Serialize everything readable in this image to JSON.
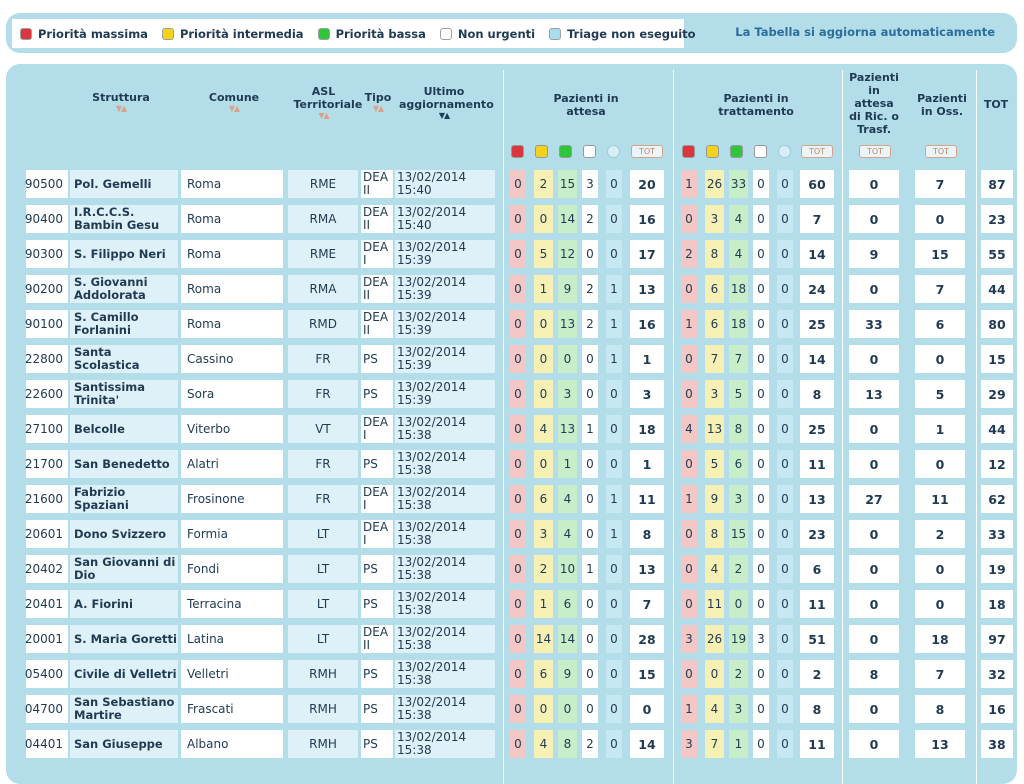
{
  "legend": {
    "items": [
      {
        "label": "Priorità massima",
        "color": "#d9363e"
      },
      {
        "label": "Priorità intermedia",
        "color": "#f2d21b"
      },
      {
        "label": "Priorità bassa",
        "color": "#2fc63c"
      },
      {
        "label": "Non urgenti",
        "color": "#ffffff"
      },
      {
        "label": "Triage non eseguito",
        "color": "#a9dcec"
      }
    ],
    "auto_update": "La Tabella si aggiorna automaticamente"
  },
  "headers": {
    "struttura": "Struttura",
    "comune": "Comune",
    "asl": "ASL Territoriale",
    "tipo": "Tipo",
    "ultimo": "Ultimo aggiornamento",
    "attesa": "Pazienti in attesa",
    "trattamento": "Pazienti in trattamento",
    "ric": "Pazienti in attesa di Ric. o Trasf.",
    "oss": "Pazienti in Oss.",
    "tot": "TOT",
    "tot_small": "TOT"
  },
  "rows": [
    {
      "code": "90500",
      "name": "Pol. Gemelli",
      "comune": "Roma",
      "asl": "RME",
      "tipo": "DEA II",
      "agg": "13/02/2014 15:40",
      "a": [
        "0",
        "2",
        "15",
        "3",
        "0"
      ],
      "at": "20",
      "t": [
        "1",
        "26",
        "33",
        "0",
        "0"
      ],
      "tt": "60",
      "ric": "0",
      "oss": "7",
      "tot": "87"
    },
    {
      "code": "90400",
      "name": "I.R.C.C.S. Bambin Gesu",
      "comune": "Roma",
      "asl": "RMA",
      "tipo": "DEA II",
      "agg": "13/02/2014 15:40",
      "a": [
        "0",
        "0",
        "14",
        "2",
        "0"
      ],
      "at": "16",
      "t": [
        "0",
        "3",
        "4",
        "0",
        "0"
      ],
      "tt": "7",
      "ric": "0",
      "oss": "0",
      "tot": "23"
    },
    {
      "code": "90300",
      "name": "S. Filippo Neri",
      "comune": "Roma",
      "asl": "RME",
      "tipo": "DEA I",
      "agg": "13/02/2014 15:39",
      "a": [
        "0",
        "5",
        "12",
        "0",
        "0"
      ],
      "at": "17",
      "t": [
        "2",
        "8",
        "4",
        "0",
        "0"
      ],
      "tt": "14",
      "ric": "9",
      "oss": "15",
      "tot": "55"
    },
    {
      "code": "90200",
      "name": "S. Giovanni Addolorata",
      "comune": "Roma",
      "asl": "RMA",
      "tipo": "DEA II",
      "agg": "13/02/2014 15:39",
      "a": [
        "0",
        "1",
        "9",
        "2",
        "1"
      ],
      "at": "13",
      "t": [
        "0",
        "6",
        "18",
        "0",
        "0"
      ],
      "tt": "24",
      "ric": "0",
      "oss": "7",
      "tot": "44"
    },
    {
      "code": "90100",
      "name": "S. Camillo Forlanini",
      "comune": "Roma",
      "asl": "RMD",
      "tipo": "DEA II",
      "agg": "13/02/2014 15:39",
      "a": [
        "0",
        "0",
        "13",
        "2",
        "1"
      ],
      "at": "16",
      "t": [
        "1",
        "6",
        "18",
        "0",
        "0"
      ],
      "tt": "25",
      "ric": "33",
      "oss": "6",
      "tot": "80"
    },
    {
      "code": "22800",
      "name": "Santa Scolastica",
      "comune": "Cassino",
      "asl": "FR",
      "tipo": "PS",
      "agg": "13/02/2014 15:39",
      "a": [
        "0",
        "0",
        "0",
        "0",
        "1"
      ],
      "at": "1",
      "t": [
        "0",
        "7",
        "7",
        "0",
        "0"
      ],
      "tt": "14",
      "ric": "0",
      "oss": "0",
      "tot": "15"
    },
    {
      "code": "22600",
      "name": "Santissima Trinita'",
      "comune": "Sora",
      "asl": "FR",
      "tipo": "PS",
      "agg": "13/02/2014 15:39",
      "a": [
        "0",
        "0",
        "3",
        "0",
        "0"
      ],
      "at": "3",
      "t": [
        "0",
        "3",
        "5",
        "0",
        "0"
      ],
      "tt": "8",
      "ric": "13",
      "oss": "5",
      "tot": "29"
    },
    {
      "code": "27100",
      "name": "Belcolle",
      "comune": "Viterbo",
      "asl": "VT",
      "tipo": "DEA I",
      "agg": "13/02/2014 15:38",
      "a": [
        "0",
        "4",
        "13",
        "1",
        "0"
      ],
      "at": "18",
      "t": [
        "4",
        "13",
        "8",
        "0",
        "0"
      ],
      "tt": "25",
      "ric": "0",
      "oss": "1",
      "tot": "44"
    },
    {
      "code": "21700",
      "name": "San Benedetto",
      "comune": "Alatri",
      "asl": "FR",
      "tipo": "PS",
      "agg": "13/02/2014 15:38",
      "a": [
        "0",
        "0",
        "1",
        "0",
        "0"
      ],
      "at": "1",
      "t": [
        "0",
        "5",
        "6",
        "0",
        "0"
      ],
      "tt": "11",
      "ric": "0",
      "oss": "0",
      "tot": "12"
    },
    {
      "code": "21600",
      "name": "Fabrizio Spaziani",
      "comune": "Frosinone",
      "asl": "FR",
      "tipo": "DEA I",
      "agg": "13/02/2014 15:38",
      "a": [
        "0",
        "6",
        "4",
        "0",
        "1"
      ],
      "at": "11",
      "t": [
        "1",
        "9",
        "3",
        "0",
        "0"
      ],
      "tt": "13",
      "ric": "27",
      "oss": "11",
      "tot": "62"
    },
    {
      "code": "20601",
      "name": "Dono Svizzero",
      "comune": "Formia",
      "asl": "LT",
      "tipo": "DEA I",
      "agg": "13/02/2014 15:38",
      "a": [
        "0",
        "3",
        "4",
        "0",
        "1"
      ],
      "at": "8",
      "t": [
        "0",
        "8",
        "15",
        "0",
        "0"
      ],
      "tt": "23",
      "ric": "0",
      "oss": "2",
      "tot": "33"
    },
    {
      "code": "20402",
      "name": "San Giovanni di Dio",
      "comune": "Fondi",
      "asl": "LT",
      "tipo": "PS",
      "agg": "13/02/2014 15:38",
      "a": [
        "0",
        "2",
        "10",
        "1",
        "0"
      ],
      "at": "13",
      "t": [
        "0",
        "4",
        "2",
        "0",
        "0"
      ],
      "tt": "6",
      "ric": "0",
      "oss": "0",
      "tot": "19"
    },
    {
      "code": "20401",
      "name": "A. Fiorini",
      "comune": "Terracina",
      "asl": "LT",
      "tipo": "PS",
      "agg": "13/02/2014 15:38",
      "a": [
        "0",
        "1",
        "6",
        "0",
        "0"
      ],
      "at": "7",
      "t": [
        "0",
        "11",
        "0",
        "0",
        "0"
      ],
      "tt": "11",
      "ric": "0",
      "oss": "0",
      "tot": "18"
    },
    {
      "code": "20001",
      "name": "S. Maria Goretti",
      "comune": "Latina",
      "asl": "LT",
      "tipo": "DEA II",
      "agg": "13/02/2014 15:38",
      "a": [
        "0",
        "14",
        "14",
        "0",
        "0"
      ],
      "at": "28",
      "t": [
        "3",
        "26",
        "19",
        "3",
        "0"
      ],
      "tt": "51",
      "ric": "0",
      "oss": "18",
      "tot": "97"
    },
    {
      "code": "05400",
      "name": "Civile di Velletri",
      "comune": "Velletri",
      "asl": "RMH",
      "tipo": "PS",
      "agg": "13/02/2014 15:38",
      "a": [
        "0",
        "6",
        "9",
        "0",
        "0"
      ],
      "at": "15",
      "t": [
        "0",
        "0",
        "2",
        "0",
        "0"
      ],
      "tt": "2",
      "ric": "8",
      "oss": "7",
      "tot": "32"
    },
    {
      "code": "04700",
      "name": "San Sebastiano Martire",
      "comune": "Frascati",
      "asl": "RMH",
      "tipo": "PS",
      "agg": "13/02/2014 15:38",
      "a": [
        "0",
        "0",
        "0",
        "0",
        "0"
      ],
      "at": "0",
      "t": [
        "1",
        "4",
        "3",
        "0",
        "0"
      ],
      "tt": "8",
      "ric": "0",
      "oss": "8",
      "tot": "16"
    },
    {
      "code": "04401",
      "name": "San Giuseppe",
      "comune": "Albano",
      "asl": "RMH",
      "tipo": "PS",
      "agg": "13/02/2014 15:38",
      "a": [
        "0",
        "4",
        "8",
        "2",
        "0"
      ],
      "at": "14",
      "t": [
        "3",
        "7",
        "1",
        "0",
        "0"
      ],
      "tt": "11",
      "ric": "0",
      "oss": "13",
      "tot": "38"
    }
  ]
}
